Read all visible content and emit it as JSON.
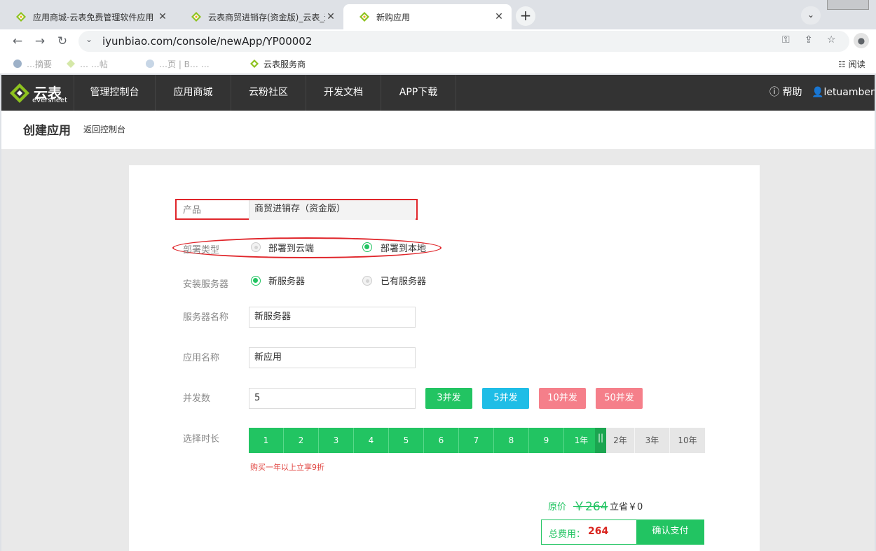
{
  "browser": {
    "tabs": [
      {
        "title": "应用商城-云表免费管理软件应用",
        "close": "✕"
      },
      {
        "title": "云表商贸进销存(资金版)_云表_无",
        "close": "✕"
      },
      {
        "title": "新购应用",
        "close": "✕"
      }
    ],
    "url": "iyunbiao.com/console/newApp/YP00002",
    "bookmarks": [
      {
        "label": "…摘要"
      },
      {
        "label": "… …帖"
      },
      {
        "label": "…页 | B… …"
      },
      {
        "label": "云表服务商"
      },
      {
        "label": "阅读"
      }
    ]
  },
  "site": {
    "brand": "云表",
    "brand_sub": "eversheet",
    "nav": [
      "管理控制台",
      "应用商城",
      "云粉社区",
      "开发文档",
      "APP下载"
    ],
    "help": "帮助",
    "user": "letuamber"
  },
  "page": {
    "title": "创建应用",
    "back": "返回控制台"
  },
  "form": {
    "product_label": "产品",
    "product_value": "商贸进销存（资金版）",
    "deploy_label": "部署类型",
    "deploy_cloud": "部署到云端",
    "deploy_local": "部署到本地",
    "server_label": "安装服务器",
    "server_new": "新服务器",
    "server_existing": "已有服务器",
    "server_name_label": "服务器名称",
    "server_name_value": "新服务器",
    "app_name_label": "应用名称",
    "app_name_value": "新应用",
    "concurrency_label": "并发数",
    "concurrency_value": "5",
    "presets": [
      "3并发",
      "5并发",
      "10并发",
      "50并发"
    ],
    "duration_label": "选择时长",
    "duration_cells": [
      "1",
      "2",
      "3",
      "4",
      "5",
      "6",
      "7",
      "8",
      "9",
      "1年",
      "2年",
      "3年",
      "10年"
    ],
    "duration_selected_index": 9,
    "handle_glyph": "||",
    "duration_hint": "购买一年以上立享9折"
  },
  "price": {
    "original_label": "原价",
    "original_value": "￥264",
    "save_text": "立省￥0",
    "total_label": "总费用：",
    "total_value": "264",
    "pay_button": "确认支付"
  },
  "colors": {
    "accent_green": "#22c462",
    "preset_blue": "#1fbde6",
    "preset_pink": "#f57f8a",
    "highlight_red": "#e0262b",
    "nav_dark": "#333333"
  }
}
